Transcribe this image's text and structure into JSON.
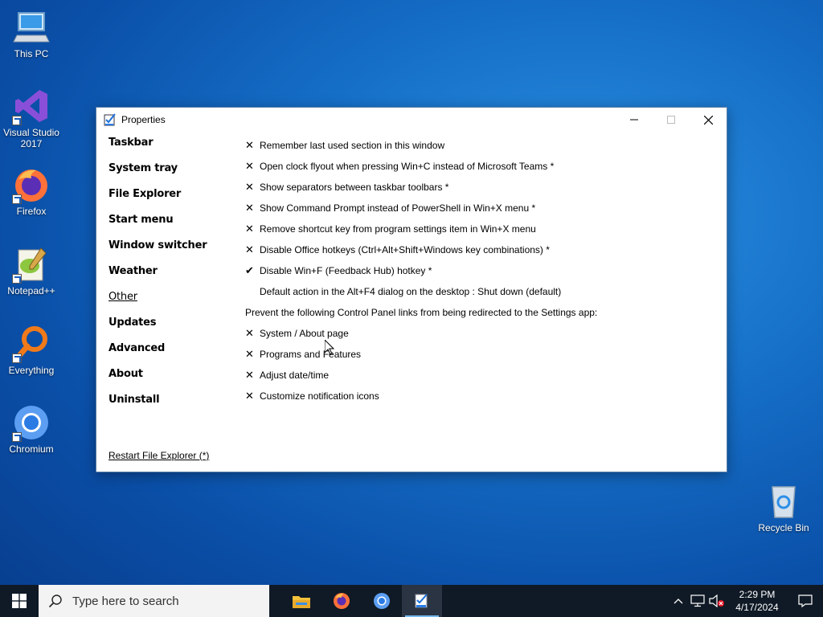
{
  "desktop": {
    "icons": [
      {
        "label": "This PC"
      },
      {
        "label": "Visual Studio 2017"
      },
      {
        "label": "Firefox"
      },
      {
        "label": "Notepad++"
      },
      {
        "label": "Everything"
      },
      {
        "label": "Chromium"
      }
    ],
    "recycle_bin": {
      "label": "Recycle Bin"
    }
  },
  "window": {
    "title": "Properties",
    "nav": [
      {
        "label": "Taskbar"
      },
      {
        "label": "System tray"
      },
      {
        "label": "File Explorer"
      },
      {
        "label": "Start menu"
      },
      {
        "label": "Window switcher"
      },
      {
        "label": "Weather"
      },
      {
        "label": "Other",
        "active": true
      },
      {
        "label": "Updates"
      },
      {
        "label": "Advanced"
      },
      {
        "label": "About"
      },
      {
        "label": "Uninstall"
      }
    ],
    "options": [
      {
        "mark": "✕",
        "label": "Remember last used section in this window"
      },
      {
        "mark": "✕",
        "label": "Open clock flyout when pressing Win+C instead of Microsoft Teams *"
      },
      {
        "mark": "✕",
        "label": "Show separators between taskbar toolbars *"
      },
      {
        "mark": "✕",
        "label": "Show Command Prompt instead of PowerShell in Win+X menu *"
      },
      {
        "mark": "✕",
        "label": "Remove shortcut key from program settings item in Win+X menu"
      },
      {
        "mark": "✕",
        "label": "Disable Office hotkeys (Ctrl+Alt+Shift+Windows key combinations) *"
      },
      {
        "mark": "✔",
        "label": "Disable Win+F (Feedback Hub) hotkey *"
      },
      {
        "mark": "",
        "label": "Default action in the Alt+F4 dialog on the desktop : Shut down (default)"
      }
    ],
    "section_heading": "Prevent the following Control Panel links from being redirected to the Settings app:",
    "redirect_options": [
      {
        "mark": "✕",
        "label": "System / About page"
      },
      {
        "mark": "✕",
        "label": "Programs and Features"
      },
      {
        "mark": "✕",
        "label": "Adjust date/time"
      },
      {
        "mark": "✕",
        "label": "Customize notification icons"
      }
    ],
    "restart_link": "Restart File Explorer (*)"
  },
  "taskbar": {
    "search_placeholder": "Type here to search",
    "apps": [
      "file-explorer",
      "firefox",
      "chromium",
      "properties"
    ],
    "clock": {
      "time": "2:29 PM",
      "date": "4/17/2024"
    }
  }
}
